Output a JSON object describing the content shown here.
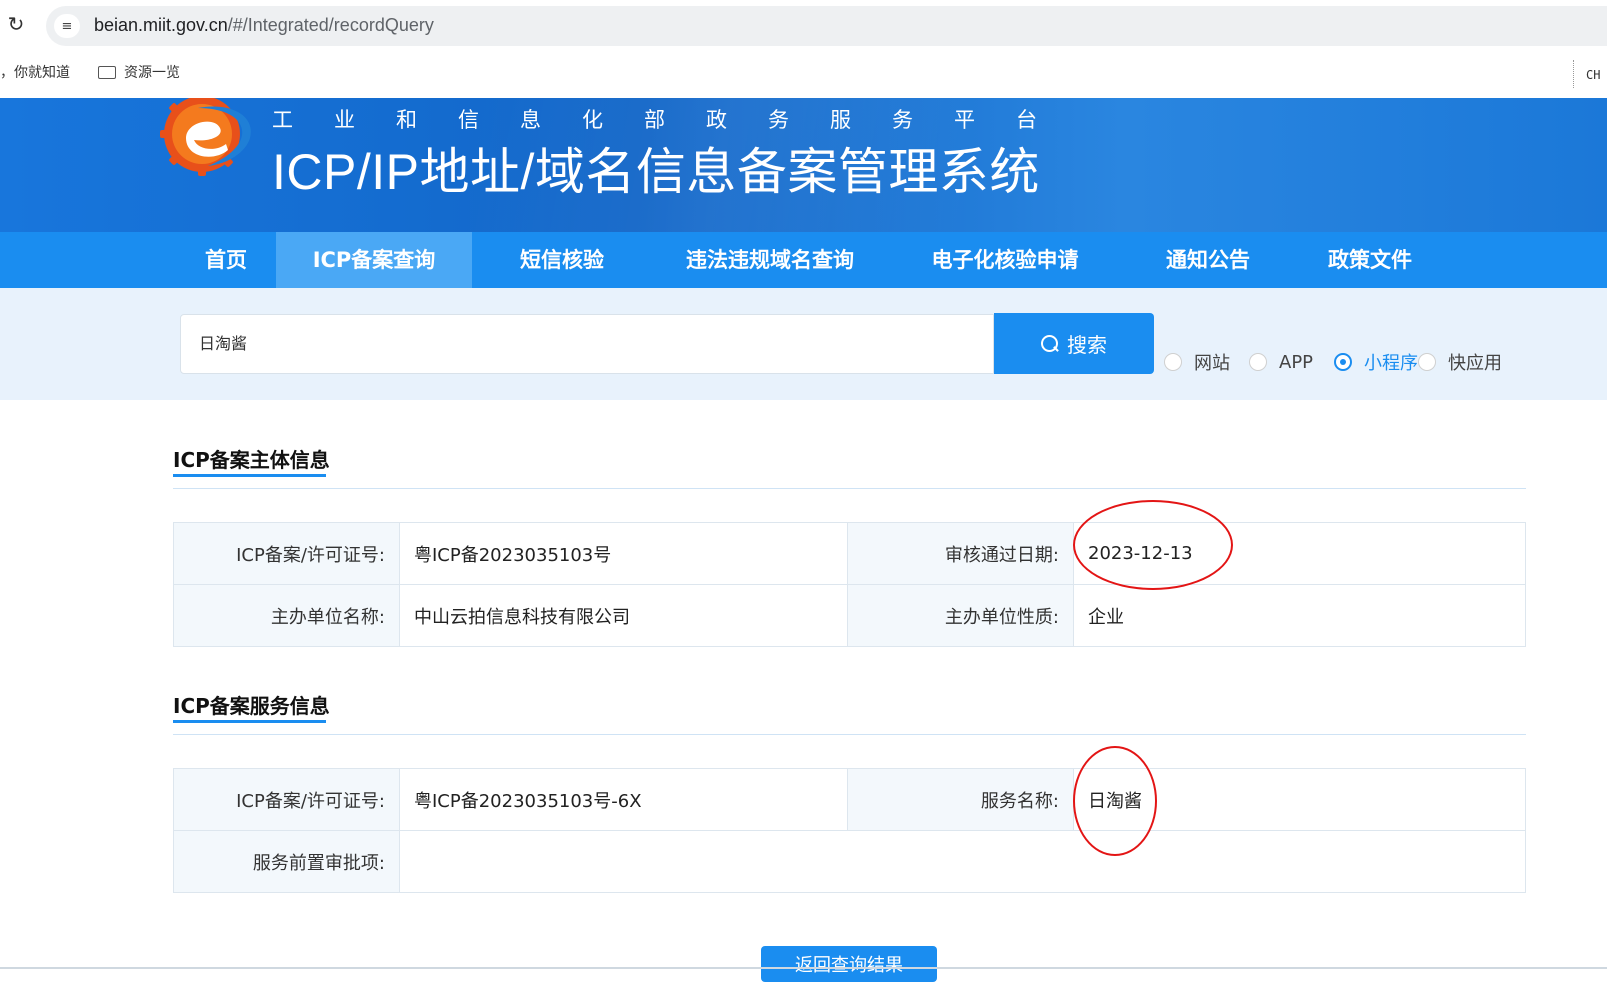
{
  "browser": {
    "url_host": "beian.miit.gov.cn",
    "url_path": "/#/Integrated/recordQuery",
    "bookmarks": [
      {
        "label": "，你就知道"
      },
      {
        "label": "资源一览"
      }
    ],
    "ext_label": "CH"
  },
  "header": {
    "platform_name": "工业和信息化部政务服务平台",
    "system_title": "ICP/IP地址/域名信息备案管理系统"
  },
  "nav": {
    "items": [
      {
        "label": "首页"
      },
      {
        "label": "ICP备案查询"
      },
      {
        "label": "短信核验"
      },
      {
        "label": "违法违规域名查询"
      },
      {
        "label": "电子化核验申请"
      },
      {
        "label": "通知公告"
      },
      {
        "label": "政策文件"
      }
    ],
    "active_index": 1
  },
  "search": {
    "value": "日淘酱",
    "button_label": "搜索",
    "types": [
      {
        "label": "网站",
        "selected": false
      },
      {
        "label": "APP",
        "selected": false
      },
      {
        "label": "小程序",
        "selected": true
      },
      {
        "label": "快应用",
        "selected": false
      }
    ]
  },
  "subject_info": {
    "heading": "ICP备案主体信息",
    "license_label": "ICP备案/许可证号:",
    "license_value": "粤ICP备2023035103号",
    "approve_date_label": "审核通过日期:",
    "approve_date_value": "2023-12-13",
    "org_name_label": "主办单位名称:",
    "org_name_value": "中山云拍信息科技有限公司",
    "org_type_label": "主办单位性质:",
    "org_type_value": "企业"
  },
  "service_info": {
    "heading": "ICP备案服务信息",
    "license_label": "ICP备案/许可证号:",
    "license_value": "粤ICP备2023035103号-6X",
    "service_name_label": "服务名称:",
    "service_name_value": "日淘酱",
    "pre_approval_label": "服务前置审批项:",
    "pre_approval_value": ""
  },
  "back_button_label": "返回查询结果",
  "colors": {
    "primary": "#1a8df0",
    "nav_active": "#4aa8f5",
    "annotation": "#e31515"
  }
}
